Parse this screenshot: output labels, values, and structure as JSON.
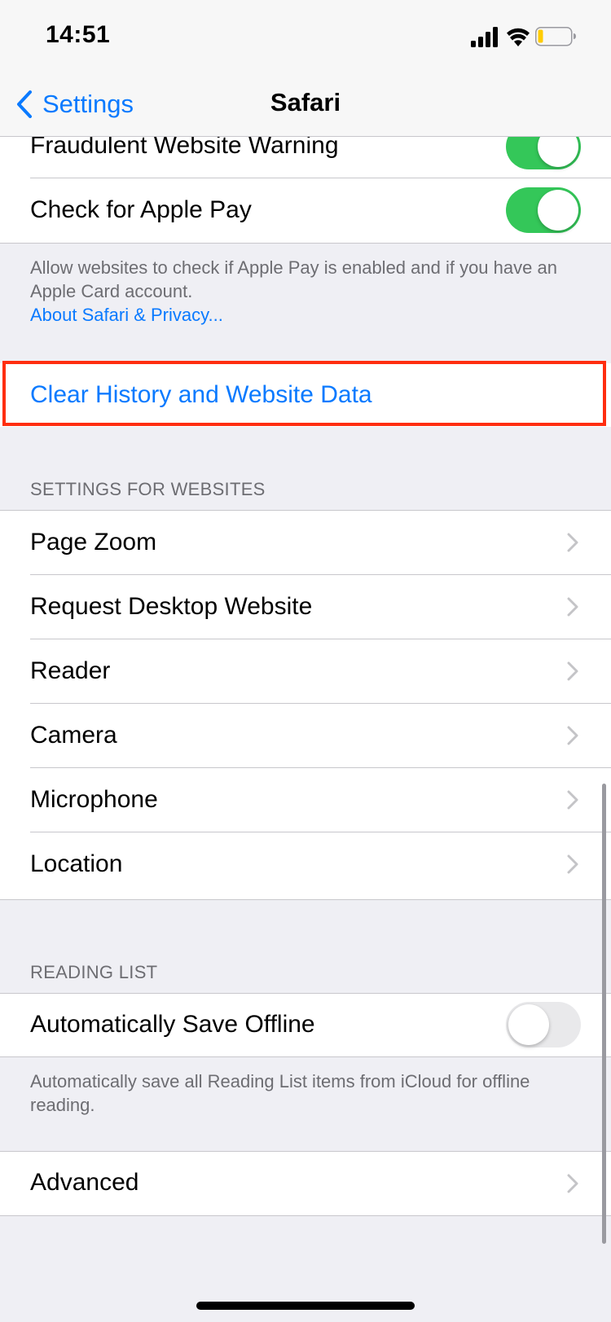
{
  "status_bar": {
    "time": "14:51"
  },
  "nav": {
    "back_label": "Settings",
    "title": "Safari"
  },
  "privacy": {
    "rows": [
      {
        "label": "Fraudulent Website Warning",
        "toggle": "on"
      },
      {
        "label": "Check for Apple Pay",
        "toggle": "on"
      }
    ],
    "footer": "Allow websites to check if Apple Pay is enabled and if you have an Apple Card account.",
    "footer_link": "About Safari & Privacy..."
  },
  "clear_history": {
    "label": "Clear History and Website Data"
  },
  "settings_for_websites": {
    "header": "SETTINGS FOR WEBSITES",
    "items": [
      {
        "label": "Page Zoom"
      },
      {
        "label": "Request Desktop Website"
      },
      {
        "label": "Reader"
      },
      {
        "label": "Camera"
      },
      {
        "label": "Microphone"
      },
      {
        "label": "Location"
      }
    ]
  },
  "reading_list": {
    "header": "READING LIST",
    "row": {
      "label": "Automatically Save Offline",
      "toggle": "off"
    },
    "footer": "Automatically save all Reading List items from iCloud for offline reading."
  },
  "advanced": {
    "label": "Advanced"
  },
  "colors": {
    "accent": "#0a7aff",
    "toggle_on": "#34c759",
    "highlight": "#ff2d0f",
    "background": "#efeff4"
  }
}
